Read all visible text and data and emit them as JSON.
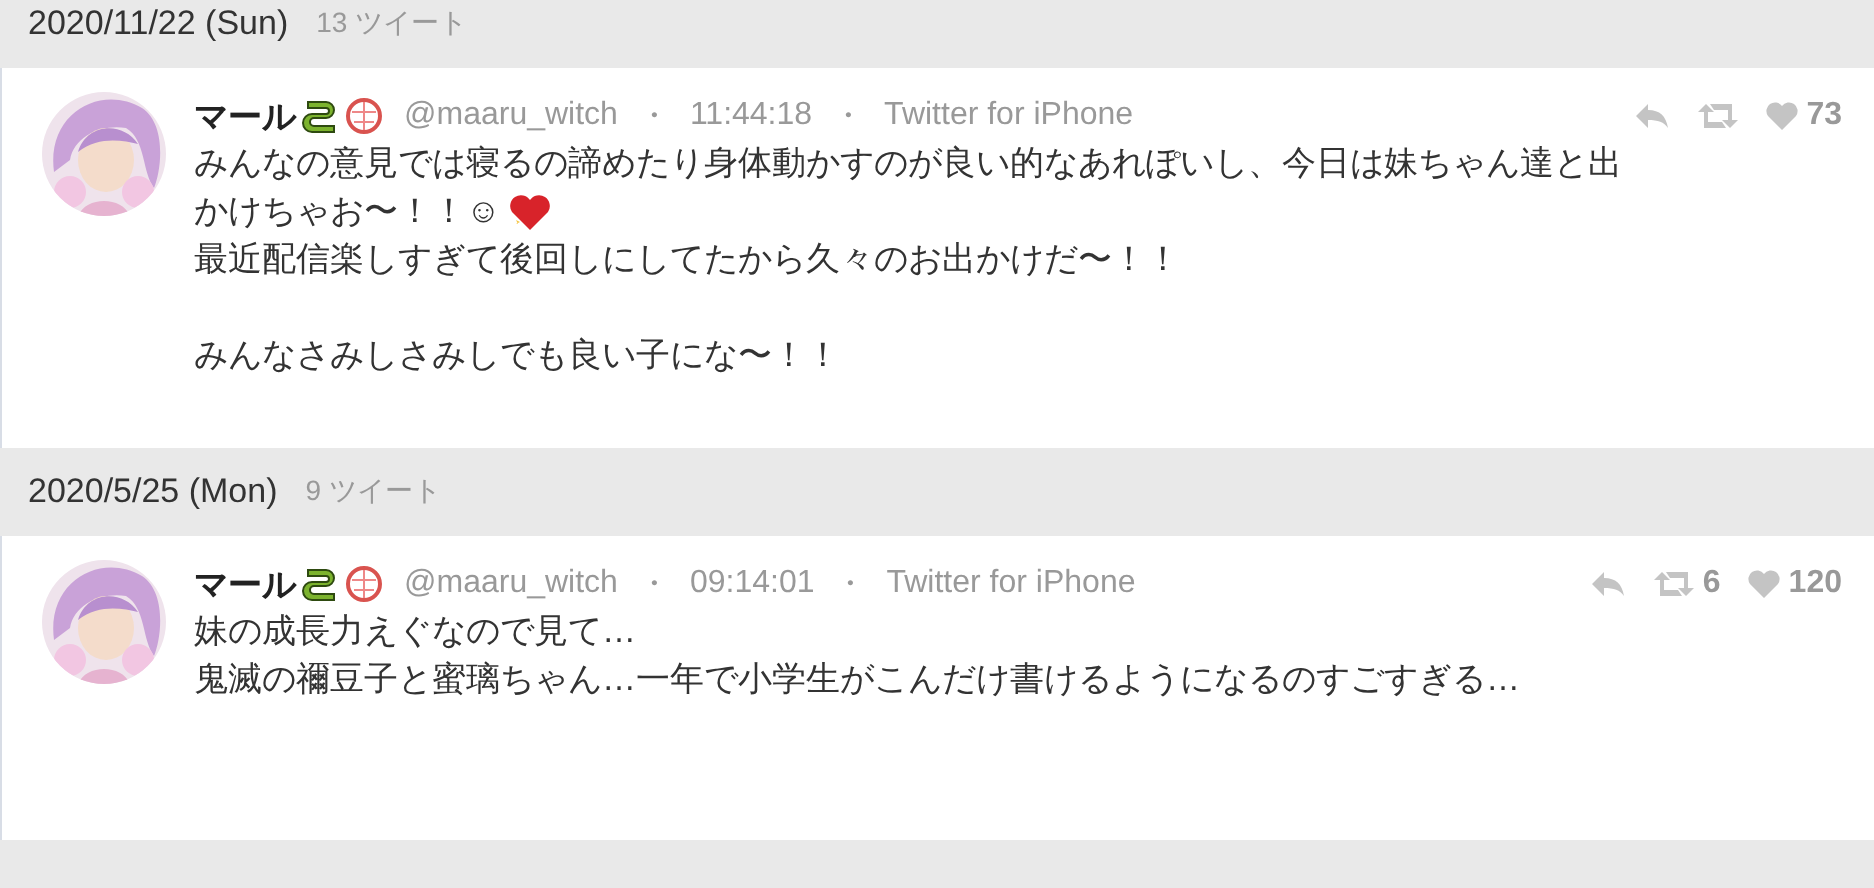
{
  "days": [
    {
      "date": "2020/11/22 (Sun)",
      "count": "13 ツイート",
      "tweets": [
        {
          "name": "マール",
          "handle": "@maaru_witch",
          "sep1": "・",
          "time": "11:44:18",
          "sep2": "・",
          "client": "Twitter for iPhone",
          "likes": "73",
          "paragraphs": [
            {
              "lines": [
                {
                  "kind": "plain",
                  "text": "みんなの意見では寝るの諦めたり身体動かすのが良い的なあれぽいし、今日は妹ちゃん達と出"
                },
                {
                  "kind": "emoji",
                  "text": "かけちゃお〜！！☺"
                },
                {
                  "kind": "plain",
                  "text": "最近配信楽しすぎて後回しにしてたから久々のお出かけだ〜！！"
                }
              ]
            },
            {
              "lines": [
                {
                  "kind": "plain",
                  "text": "みんなさみしさみしでも良い子にな〜！！"
                }
              ]
            }
          ]
        }
      ]
    },
    {
      "date": "2020/5/25 (Mon)",
      "count": "9 ツイート",
      "tweets": [
        {
          "name": "マール",
          "handle": "@maaru_witch",
          "sep1": "・",
          "time": "09:14:01",
          "sep2": "・",
          "client": "Twitter for iPhone",
          "retweets": "6",
          "likes": "120",
          "paragraphs": [
            {
              "lines": [
                {
                  "kind": "plain",
                  "text": "妹の成長力えぐなので見て…"
                },
                {
                  "kind": "plain",
                  "text": "鬼滅の禰豆子と蜜璃ちゃん…一年で小学生がこんだけ書けるようになるのすごすぎる…"
                }
              ]
            }
          ]
        }
      ]
    }
  ]
}
